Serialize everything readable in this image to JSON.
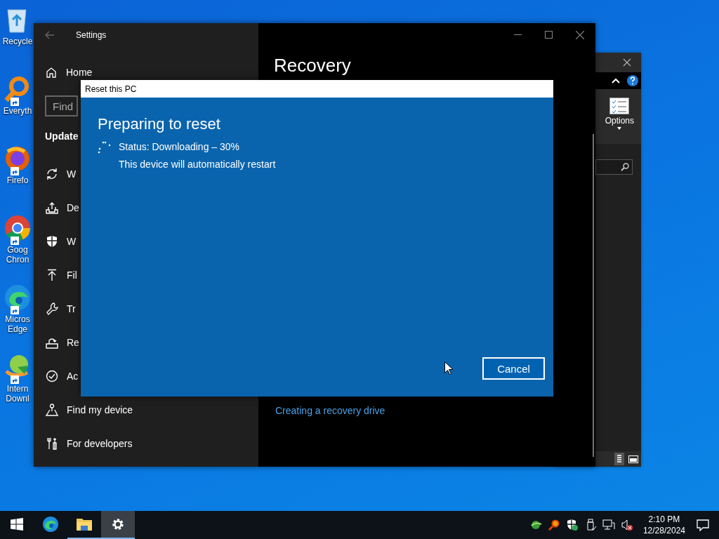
{
  "desktop_icons": [
    {
      "kind": "recycle-bin",
      "label": "Recycle",
      "shortcut": false
    },
    {
      "kind": "magnifier",
      "label": "Everyth",
      "shortcut": true
    },
    {
      "kind": "fox",
      "label": "Firefo",
      "shortcut": true
    },
    {
      "kind": "chrome",
      "label": "Goog Chron",
      "shortcut": true
    },
    {
      "kind": "edge",
      "label": "Micros Edge",
      "shortcut": true
    },
    {
      "kind": "globe",
      "label": "Intern Downl",
      "shortcut": true
    }
  ],
  "explorer_window": {
    "options_label": "Options"
  },
  "settings_window": {
    "title": "Settings",
    "home": "Home",
    "search": {
      "placeholder": "Find"
    },
    "section": "Update",
    "nav": [
      {
        "kind": "sync",
        "label": "W"
      },
      {
        "kind": "tray",
        "label": "De"
      },
      {
        "kind": "shield",
        "label": "W"
      },
      {
        "kind": "upload",
        "label": "Fil"
      },
      {
        "kind": "wrench",
        "label": "Tr"
      },
      {
        "kind": "recovery",
        "label": "Re"
      },
      {
        "kind": "check",
        "label": "Ac"
      },
      {
        "kind": "person",
        "label": "Find my device"
      },
      {
        "kind": "tools",
        "label": "For developers"
      }
    ],
    "page_title": "Recovery",
    "link": "Creating a recovery drive"
  },
  "dialog": {
    "title": "Reset this PC",
    "heading": "Preparing to reset",
    "status": "Status: Downloading – 30%",
    "note": "This device will automatically restart",
    "button": "Cancel"
  },
  "taskbar": {
    "apps": [
      {
        "kind": "start",
        "selected": false,
        "running": false
      },
      {
        "kind": "edge",
        "selected": false,
        "running": false
      },
      {
        "kind": "folder",
        "selected": false,
        "running": true
      },
      {
        "kind": "settings",
        "selected": true,
        "running": true
      }
    ],
    "time": "2:10 PM",
    "date": "12/28/2024"
  }
}
